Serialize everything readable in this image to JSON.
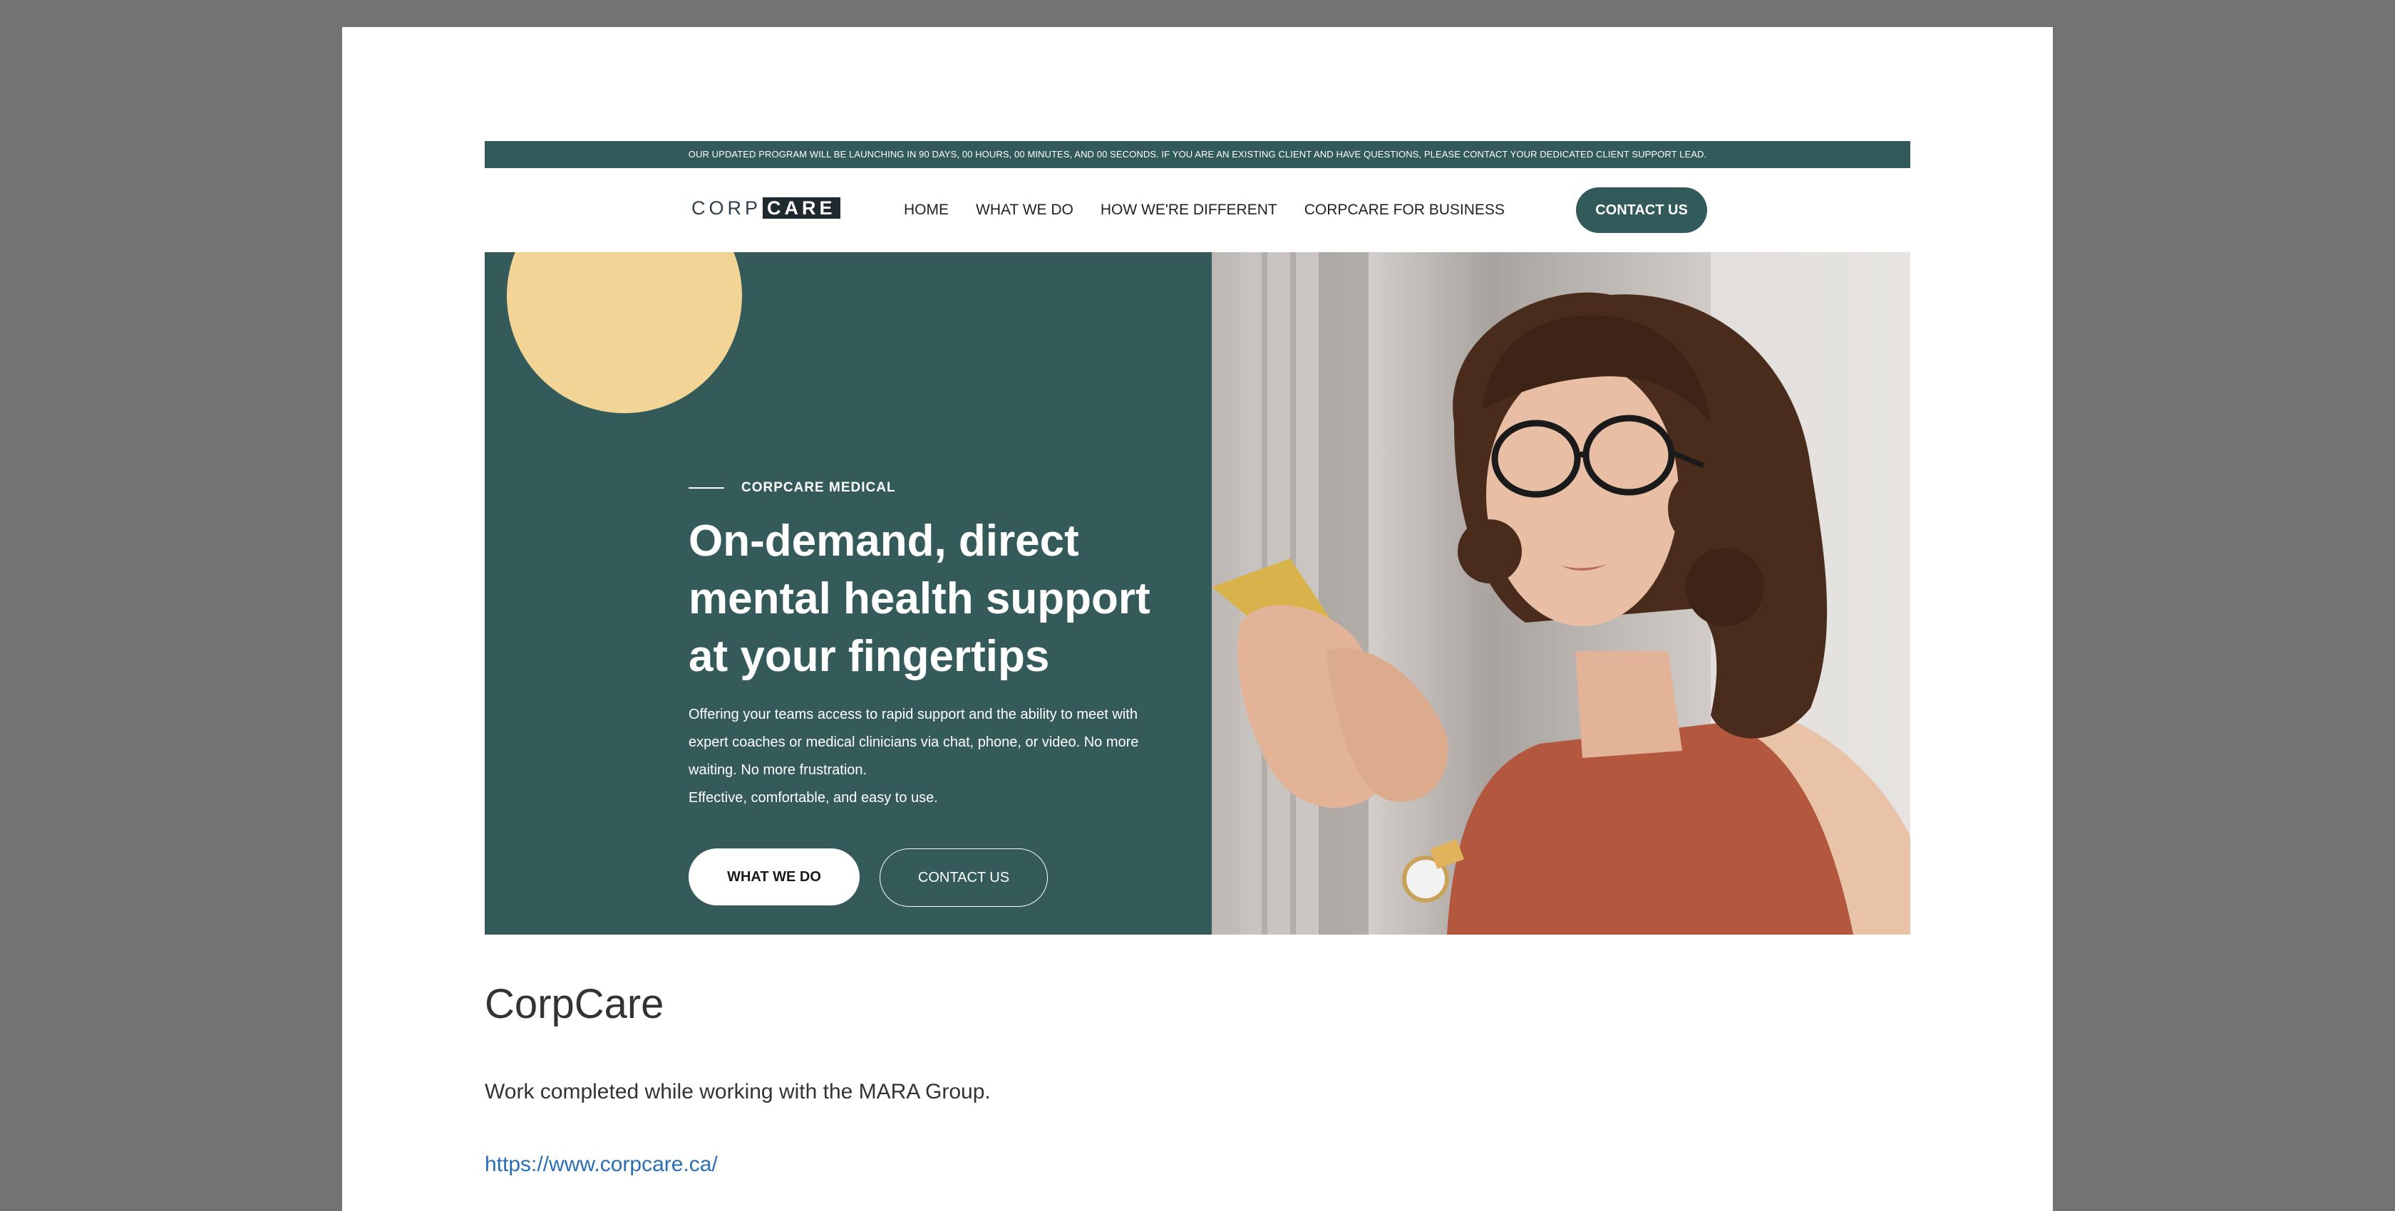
{
  "announcement": "OUR UPDATED PROGRAM WILL BE LAUNCHING IN 90 DAYS, 00 HOURS, 00 MINUTES, AND 00 SECONDS. IF YOU ARE AN EXISTING CLIENT AND HAVE QUESTIONS, PLEASE CONTACT YOUR DEDICATED CLIENT SUPPORT LEAD.",
  "logo": {
    "corp": "CORP",
    "care": "CARE"
  },
  "nav": {
    "links": [
      "HOME",
      "WHAT WE DO",
      "HOW WE'RE DIFFERENT",
      "CORPCARE FOR BUSINESS"
    ],
    "contact_label": "CONTACT US"
  },
  "hero": {
    "eyebrow": "CORPCARE MEDICAL",
    "headline": "On-demand, direct mental health support at your fingertips",
    "description": "Offering your teams access to rapid support and the ability to meet with expert coaches or medical clinicians via chat, phone, or video. No more waiting. No more frustration.",
    "tagline": "Effective, comfortable, and easy to use.",
    "primary_button": "WHAT WE DO",
    "secondary_button": "CONTACT US"
  },
  "page": {
    "title": "CorpCare",
    "subtitle": "Work completed while working with the MARA Group.",
    "link": "https://www.corpcare.ca/"
  },
  "colors": {
    "brand_teal": "#325a5a",
    "accent_yellow": "#f3d497",
    "link_blue": "#2a6db5",
    "backdrop": "#737373"
  }
}
